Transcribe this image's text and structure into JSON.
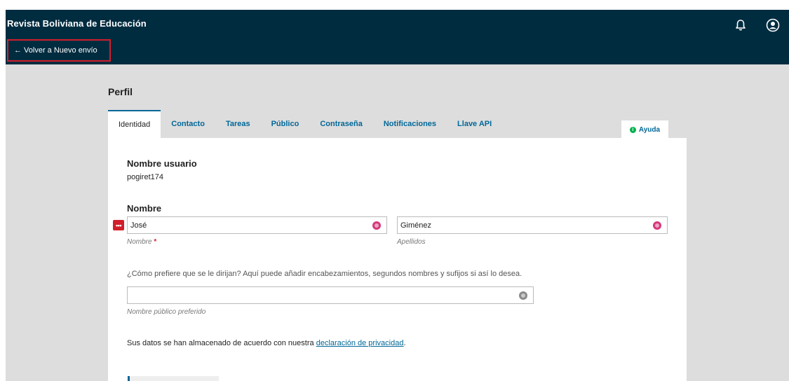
{
  "header": {
    "site_title": "Revista Boliviana de Educación",
    "back_link": "← Volver a Nuevo envío",
    "bell_icon": "bell-icon",
    "user_icon": "user-icon"
  },
  "page": {
    "title": "Perfil"
  },
  "tabs": [
    {
      "label": "Identidad",
      "active": true
    },
    {
      "label": "Contacto"
    },
    {
      "label": "Tareas"
    },
    {
      "label": "Público"
    },
    {
      "label": "Contraseña"
    },
    {
      "label": "Notificaciones"
    },
    {
      "label": "Llave API"
    }
  ],
  "help": {
    "label": "Ayuda"
  },
  "form": {
    "username_label": "Nombre usuario",
    "username_value": "pogiret174",
    "name_label": "Nombre",
    "given_name": {
      "value": "José",
      "hint": "Nombre",
      "required_mark": "*"
    },
    "family_name": {
      "value": "Giménez",
      "hint": "Apellidos"
    },
    "preferred_intro": "¿Cómo prefiere que se le dirijan? Aquí puede añadir encabezamientos, segundos nombres y sufijos si así lo desea.",
    "preferred_value": "",
    "preferred_hint": "Nombre público preferido",
    "privacy_text": "Sus datos se han almacenado de acuerdo con nuestra",
    "privacy_link": "declaración de privacidad",
    "privacy_end": "."
  },
  "colors": {
    "header_bg": "#002c40",
    "link": "#006798",
    "highlight": "#d11e2a",
    "globe_pink": "#d4397a"
  }
}
